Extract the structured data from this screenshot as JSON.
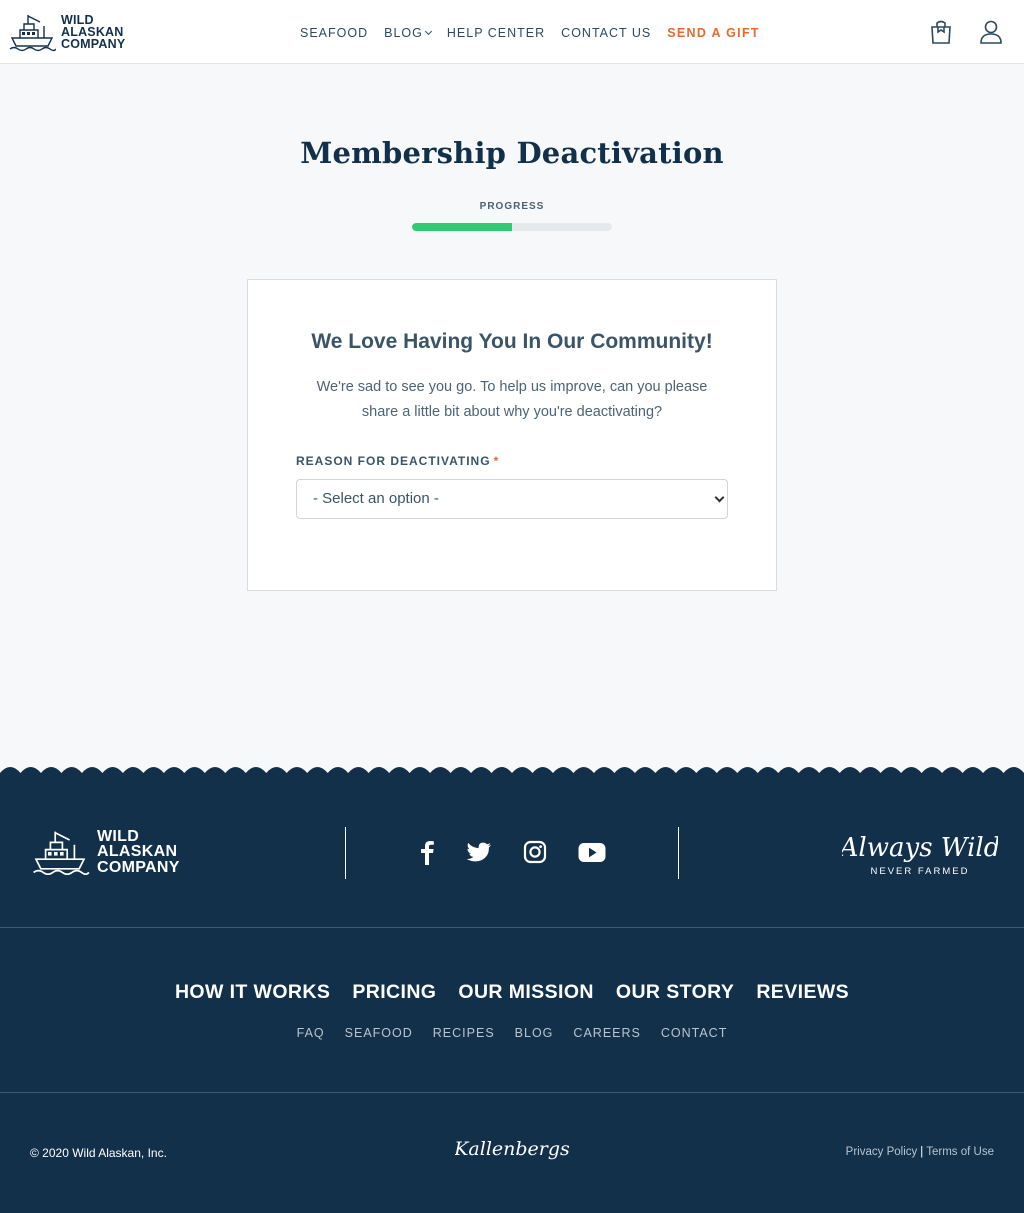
{
  "header": {
    "logo_lines": [
      "WILD",
      "ALASKAN",
      "COMPANY"
    ],
    "nav": {
      "seafood": "SEAFOOD",
      "blog": "BLOG",
      "help": "HELP CENTER",
      "contact": "CONTACT US",
      "gift": "SEND A GIFT"
    },
    "icons": [
      "cart-icon",
      "user-icon"
    ]
  },
  "main": {
    "title": "Membership Deactivation",
    "progress_label": "PROGRESS",
    "progress_fraction": 0.5,
    "card": {
      "heading": "We Love Having You In Our Community!",
      "text": "We're sad to see you go. To help us improve, can you please share a little bit about why you're deactivating?",
      "field_label": "REASON FOR DEACTIVATING",
      "required_mark": "*",
      "select_value": "- Select an option -"
    }
  },
  "footer": {
    "logo_lines": [
      "WILD",
      "ALASKAN",
      "COMPANY"
    ],
    "social": [
      "facebook-icon",
      "twitter-icon",
      "instagram-icon",
      "youtube-icon"
    ],
    "tagline_script": "Always Wild",
    "tagline_sub": "NEVER FARMED",
    "primary_links": [
      "HOW IT WORKS",
      "PRICING",
      "OUR MISSION",
      "OUR STORY",
      "REVIEWS"
    ],
    "secondary_links": [
      "FAQ",
      "SEAFOOD",
      "RECIPES",
      "BLOG",
      "CAREERS",
      "CONTACT"
    ],
    "copyright": "© 2020 Wild Alaskan, Inc.",
    "partner": "Kallenbergs",
    "privacy": "Privacy Policy",
    "separator": "|",
    "terms": "Terms of Use"
  },
  "colors": {
    "navy": "#13304a",
    "accent_orange": "#e9692c",
    "progress_green": "#2ecc71",
    "page_bg": "#f6f8f9"
  }
}
